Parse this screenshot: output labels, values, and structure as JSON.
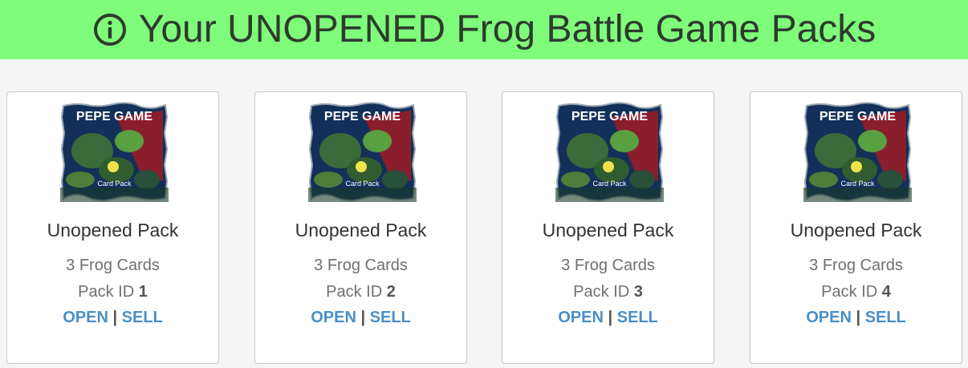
{
  "banner": {
    "icon": "info-icon",
    "title": "Your UNOPENED Frog Battle Game Packs",
    "background": "#7efc7a"
  },
  "packs": [
    {
      "image_title": "PEPE GAME",
      "image_caption": "Card Pack",
      "name": "Unopened Pack",
      "cards": "3 Frog Cards",
      "id_label": "Pack ID",
      "id": "1",
      "open_label": "OPEN",
      "separator": "|",
      "sell_label": "SELL"
    },
    {
      "image_title": "PEPE GAME",
      "image_caption": "Card Pack",
      "name": "Unopened Pack",
      "cards": "3 Frog Cards",
      "id_label": "Pack ID",
      "id": "2",
      "open_label": "OPEN",
      "separator": "|",
      "sell_label": "SELL"
    },
    {
      "image_title": "PEPE GAME",
      "image_caption": "Card Pack",
      "name": "Unopened Pack",
      "cards": "3 Frog Cards",
      "id_label": "Pack ID",
      "id": "3",
      "open_label": "OPEN",
      "separator": "|",
      "sell_label": "SELL"
    },
    {
      "image_title": "PEPE GAME",
      "image_caption": "Card Pack",
      "name": "Unopened Pack",
      "cards": "3 Frog Cards",
      "id_label": "Pack ID",
      "id": "4",
      "open_label": "OPEN",
      "separator": "|",
      "sell_label": "SELL"
    }
  ],
  "colors": {
    "link": "#4a8fc7",
    "pack_bg": "#12325c"
  }
}
